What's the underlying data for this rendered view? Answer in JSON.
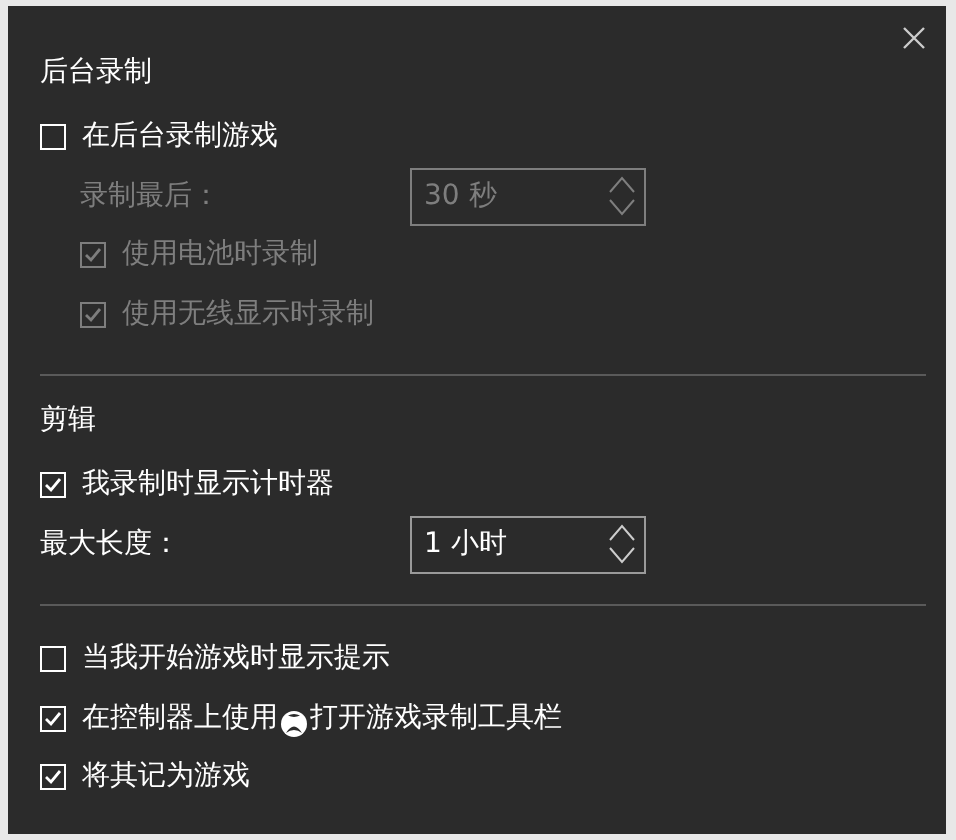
{
  "sections": [
    {
      "heading": "后台录制",
      "items": [
        {
          "kind": "checkbox",
          "label": "在后台录制游戏",
          "checked": false,
          "disabled": false,
          "children": [
            {
              "kind": "spinner",
              "label": "录制最后：",
              "value": "30 秒",
              "disabled": true
            },
            {
              "kind": "checkbox",
              "label": "使用电池时录制",
              "checked": true,
              "disabled": true
            },
            {
              "kind": "checkbox",
              "label": "使用无线显示时录制",
              "checked": true,
              "disabled": true
            }
          ]
        }
      ]
    },
    {
      "heading": "剪辑",
      "items": [
        {
          "kind": "checkbox",
          "label": "我录制时显示计时器",
          "checked": true,
          "disabled": false
        },
        {
          "kind": "spinner",
          "label": "最大长度：",
          "value": "1 小时",
          "disabled": false
        }
      ]
    },
    {
      "items": [
        {
          "kind": "checkbox",
          "label": "当我开始游戏时显示提示",
          "checked": false,
          "disabled": false
        },
        {
          "kind": "checkbox",
          "label": "在控制器上使用",
          "label_after": "打开游戏录制工具栏",
          "checked": true,
          "disabled": false
        },
        {
          "kind": "checkbox",
          "label": "将其记为游戏",
          "checked": true,
          "disabled": false
        }
      ]
    }
  ]
}
